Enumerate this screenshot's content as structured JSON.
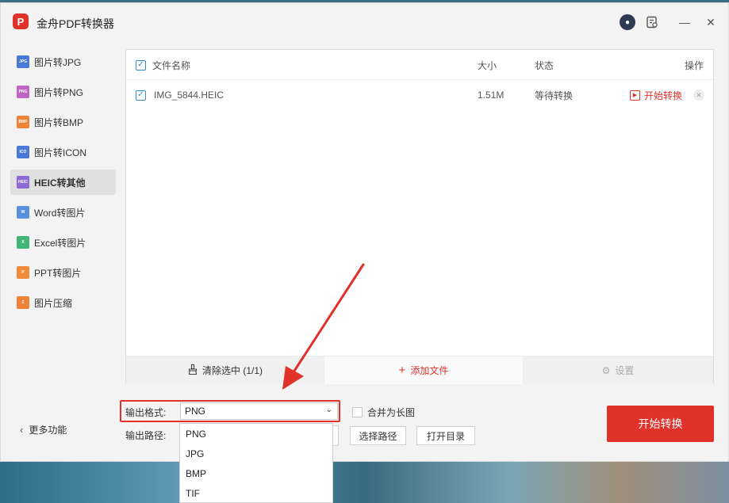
{
  "window": {
    "title": "金舟PDF转换器",
    "logo_glyph": "P"
  },
  "titlebar": {
    "min_glyph": "—",
    "close_glyph": "✕"
  },
  "sidebar": {
    "items": [
      {
        "label": "图片转JPG",
        "badge": "JPG",
        "color": "#4a78d8"
      },
      {
        "label": "图片转PNG",
        "badge": "PNG",
        "color": "#c064c6"
      },
      {
        "label": "图片转BMP",
        "badge": "BMP",
        "color": "#f0833a"
      },
      {
        "label": "图片转ICON",
        "badge": "ICO",
        "color": "#4a78d8"
      },
      {
        "label": "HEIC转其他",
        "badge": "HEIC",
        "color": "#8d6ad6",
        "active": true
      },
      {
        "label": "Word转图片",
        "badge": "W",
        "color": "#5a8fe0"
      },
      {
        "label": "Excel转图片",
        "badge": "X",
        "color": "#3fb57a"
      },
      {
        "label": "PPT转图片",
        "badge": "P",
        "color": "#f08c3a"
      },
      {
        "label": "图片压缩",
        "badge": "Z",
        "color": "#f0833a"
      }
    ],
    "more_label": "更多功能"
  },
  "table": {
    "headers": {
      "name": "文件名称",
      "size": "大小",
      "status": "状态",
      "action": "操作"
    },
    "rows": [
      {
        "name": "IMG_5844.HEIC",
        "size": "1.51M",
        "status": "等待转换",
        "action": "开始转换",
        "checked": true
      }
    ],
    "footer": {
      "clear": "清除选中 (1/1)",
      "add": "添加文件",
      "settings": "设置"
    }
  },
  "output": {
    "format_label": "输出格式:",
    "format_value": "PNG",
    "merge_label": "合并为长图",
    "path_label": "输出路径:",
    "choose_path": "选择路径",
    "open_dir": "打开目录",
    "format_options": [
      "PNG",
      "JPG",
      "BMP",
      "TIF"
    ]
  },
  "start_button": "开始转换",
  "colors": {
    "accent": "#e0322b",
    "check": "#2d8fd8"
  }
}
